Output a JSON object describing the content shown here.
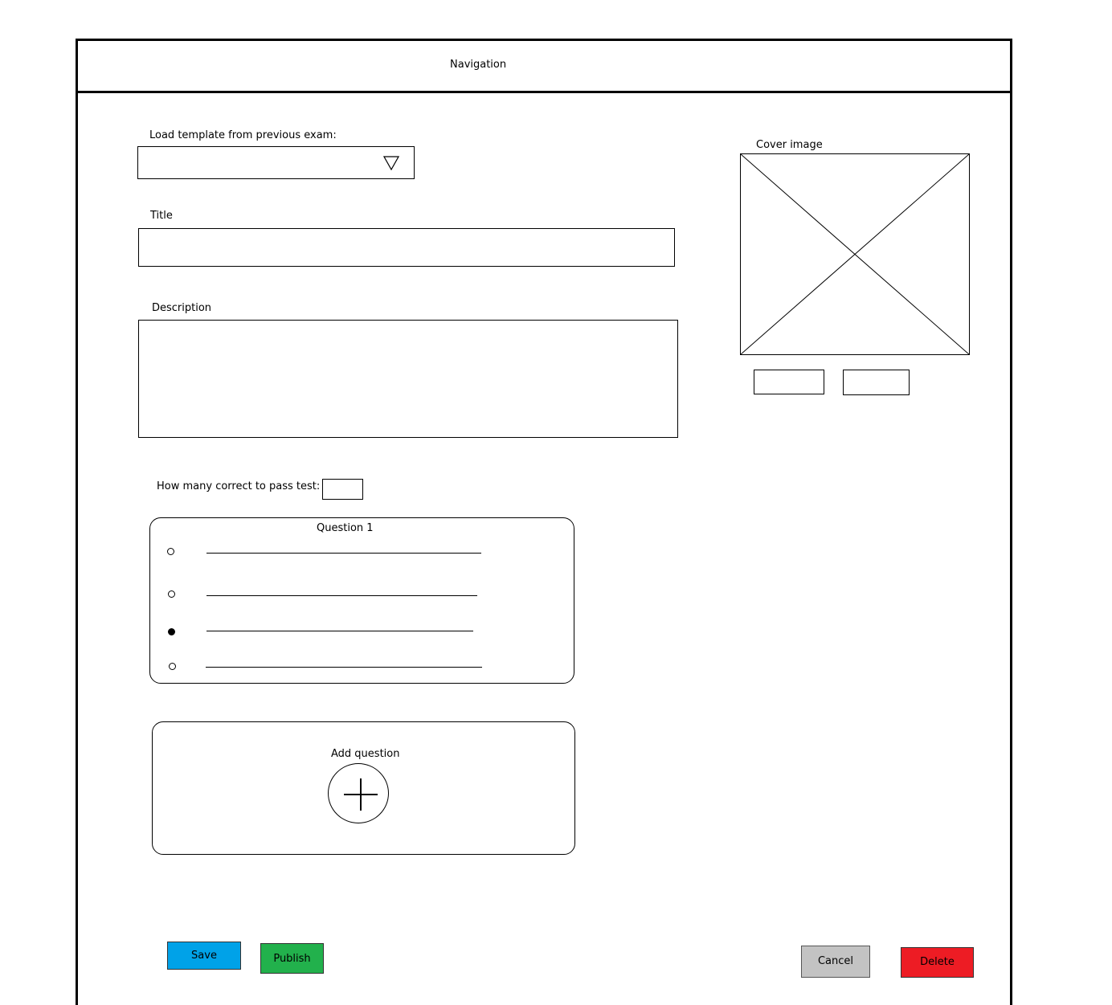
{
  "navigation": {
    "title": "Navigation"
  },
  "form": {
    "template_label": "Load template from previous exam:",
    "template_value": "",
    "title_label": "Title",
    "title_value": "",
    "description_label": "Description",
    "description_value": "",
    "pass_label": "How many correct to pass test:",
    "pass_value": ""
  },
  "cover": {
    "label": "Cover image"
  },
  "question": {
    "title": "Question 1",
    "answers": [
      {
        "selected": false
      },
      {
        "selected": false
      },
      {
        "selected": true
      },
      {
        "selected": false
      }
    ]
  },
  "add_question": {
    "label": "Add question"
  },
  "buttons": {
    "save": "Save",
    "publish": "Publish",
    "cancel": "Cancel",
    "delete": "Delete"
  },
  "colors": {
    "save": "#00a2e8",
    "publish": "#22b14c",
    "cancel": "#c3c3c3",
    "delete": "#ed1c24"
  }
}
